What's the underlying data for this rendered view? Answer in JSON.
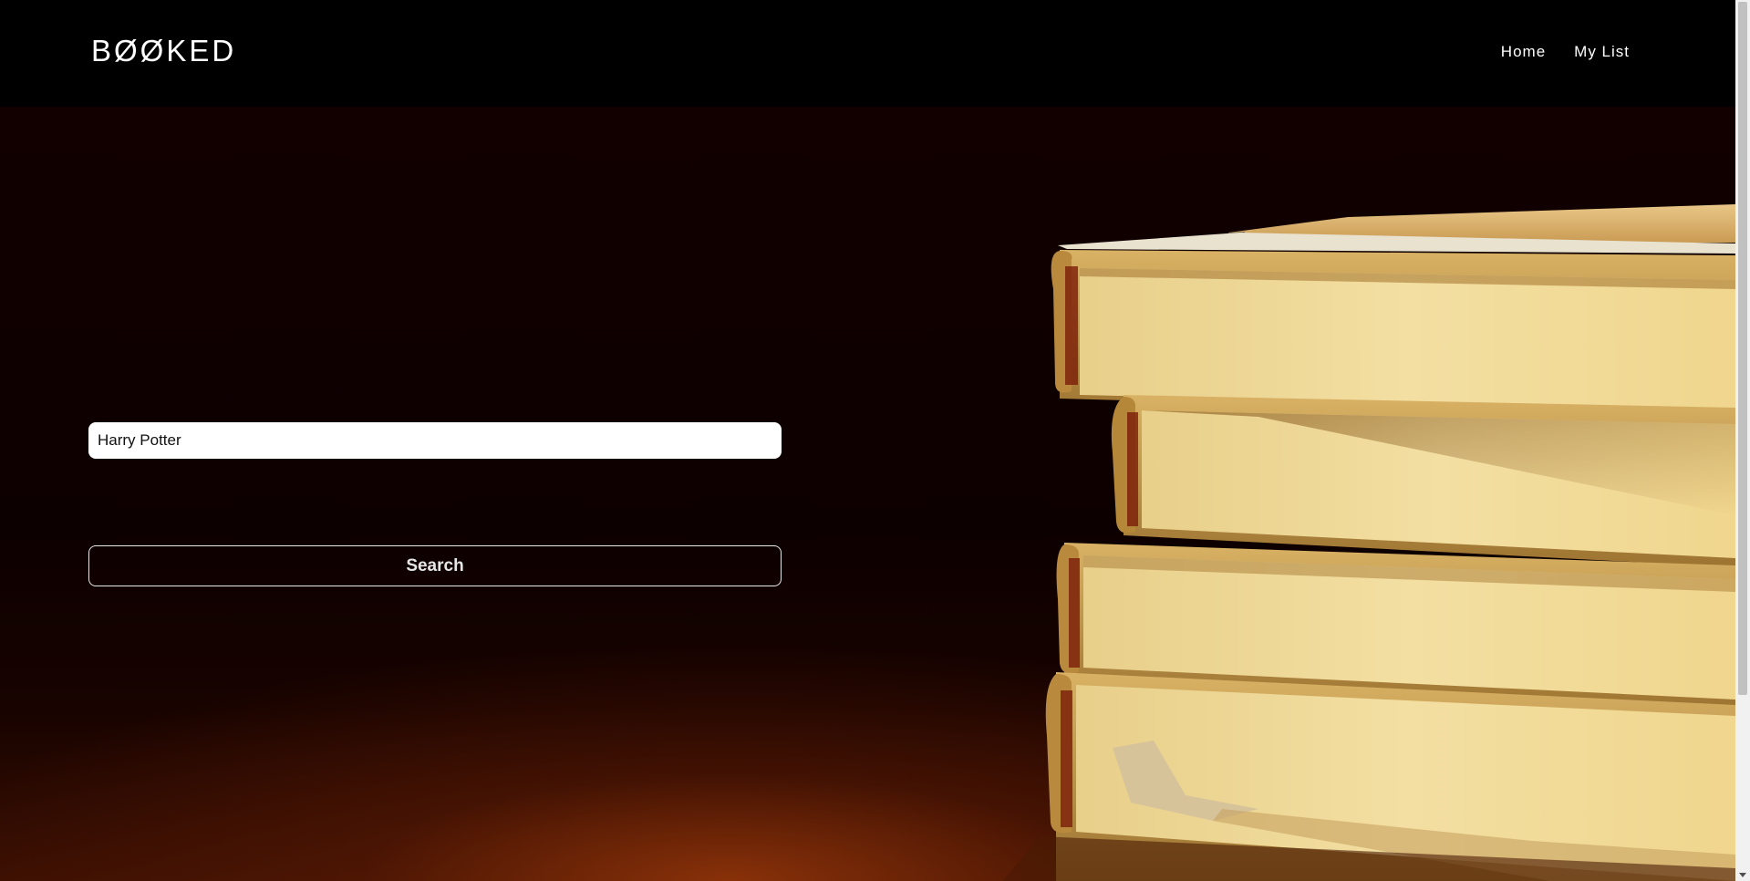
{
  "header": {
    "brand": "BØØKED",
    "nav": [
      {
        "label": "Home"
      },
      {
        "label": "My List"
      }
    ]
  },
  "search": {
    "value": "Harry Potter",
    "button_label": "Search"
  }
}
